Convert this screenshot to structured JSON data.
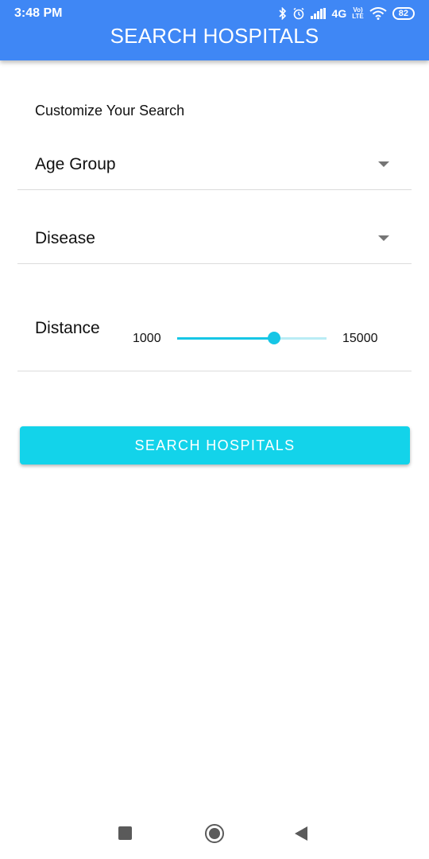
{
  "status_bar": {
    "time": "3:48 PM",
    "network": "4G",
    "volte_top": "Vo)",
    "volte_bottom": "LTE",
    "battery": "82",
    "icons": [
      "bluetooth-icon",
      "alarm-icon",
      "signal-icon",
      "wifi-icon",
      "battery-icon"
    ]
  },
  "header": {
    "title": "SEARCH HOSPITALS"
  },
  "form": {
    "section_title": "Customize Your Search",
    "age_group": {
      "label": "Age Group"
    },
    "disease": {
      "label": "Disease"
    },
    "distance": {
      "label": "Distance",
      "min_label": "1000",
      "max_label": "15000",
      "value_fraction": 0.65
    }
  },
  "search_button": {
    "label": "SEARCH HOSPITALS"
  },
  "colors": {
    "appbar": "#3f87f5",
    "accent": "#13d3ea",
    "slider_track": "#b9ecf5"
  },
  "nav_bar": {
    "icons": [
      "recents-icon",
      "home-icon",
      "back-icon"
    ]
  }
}
